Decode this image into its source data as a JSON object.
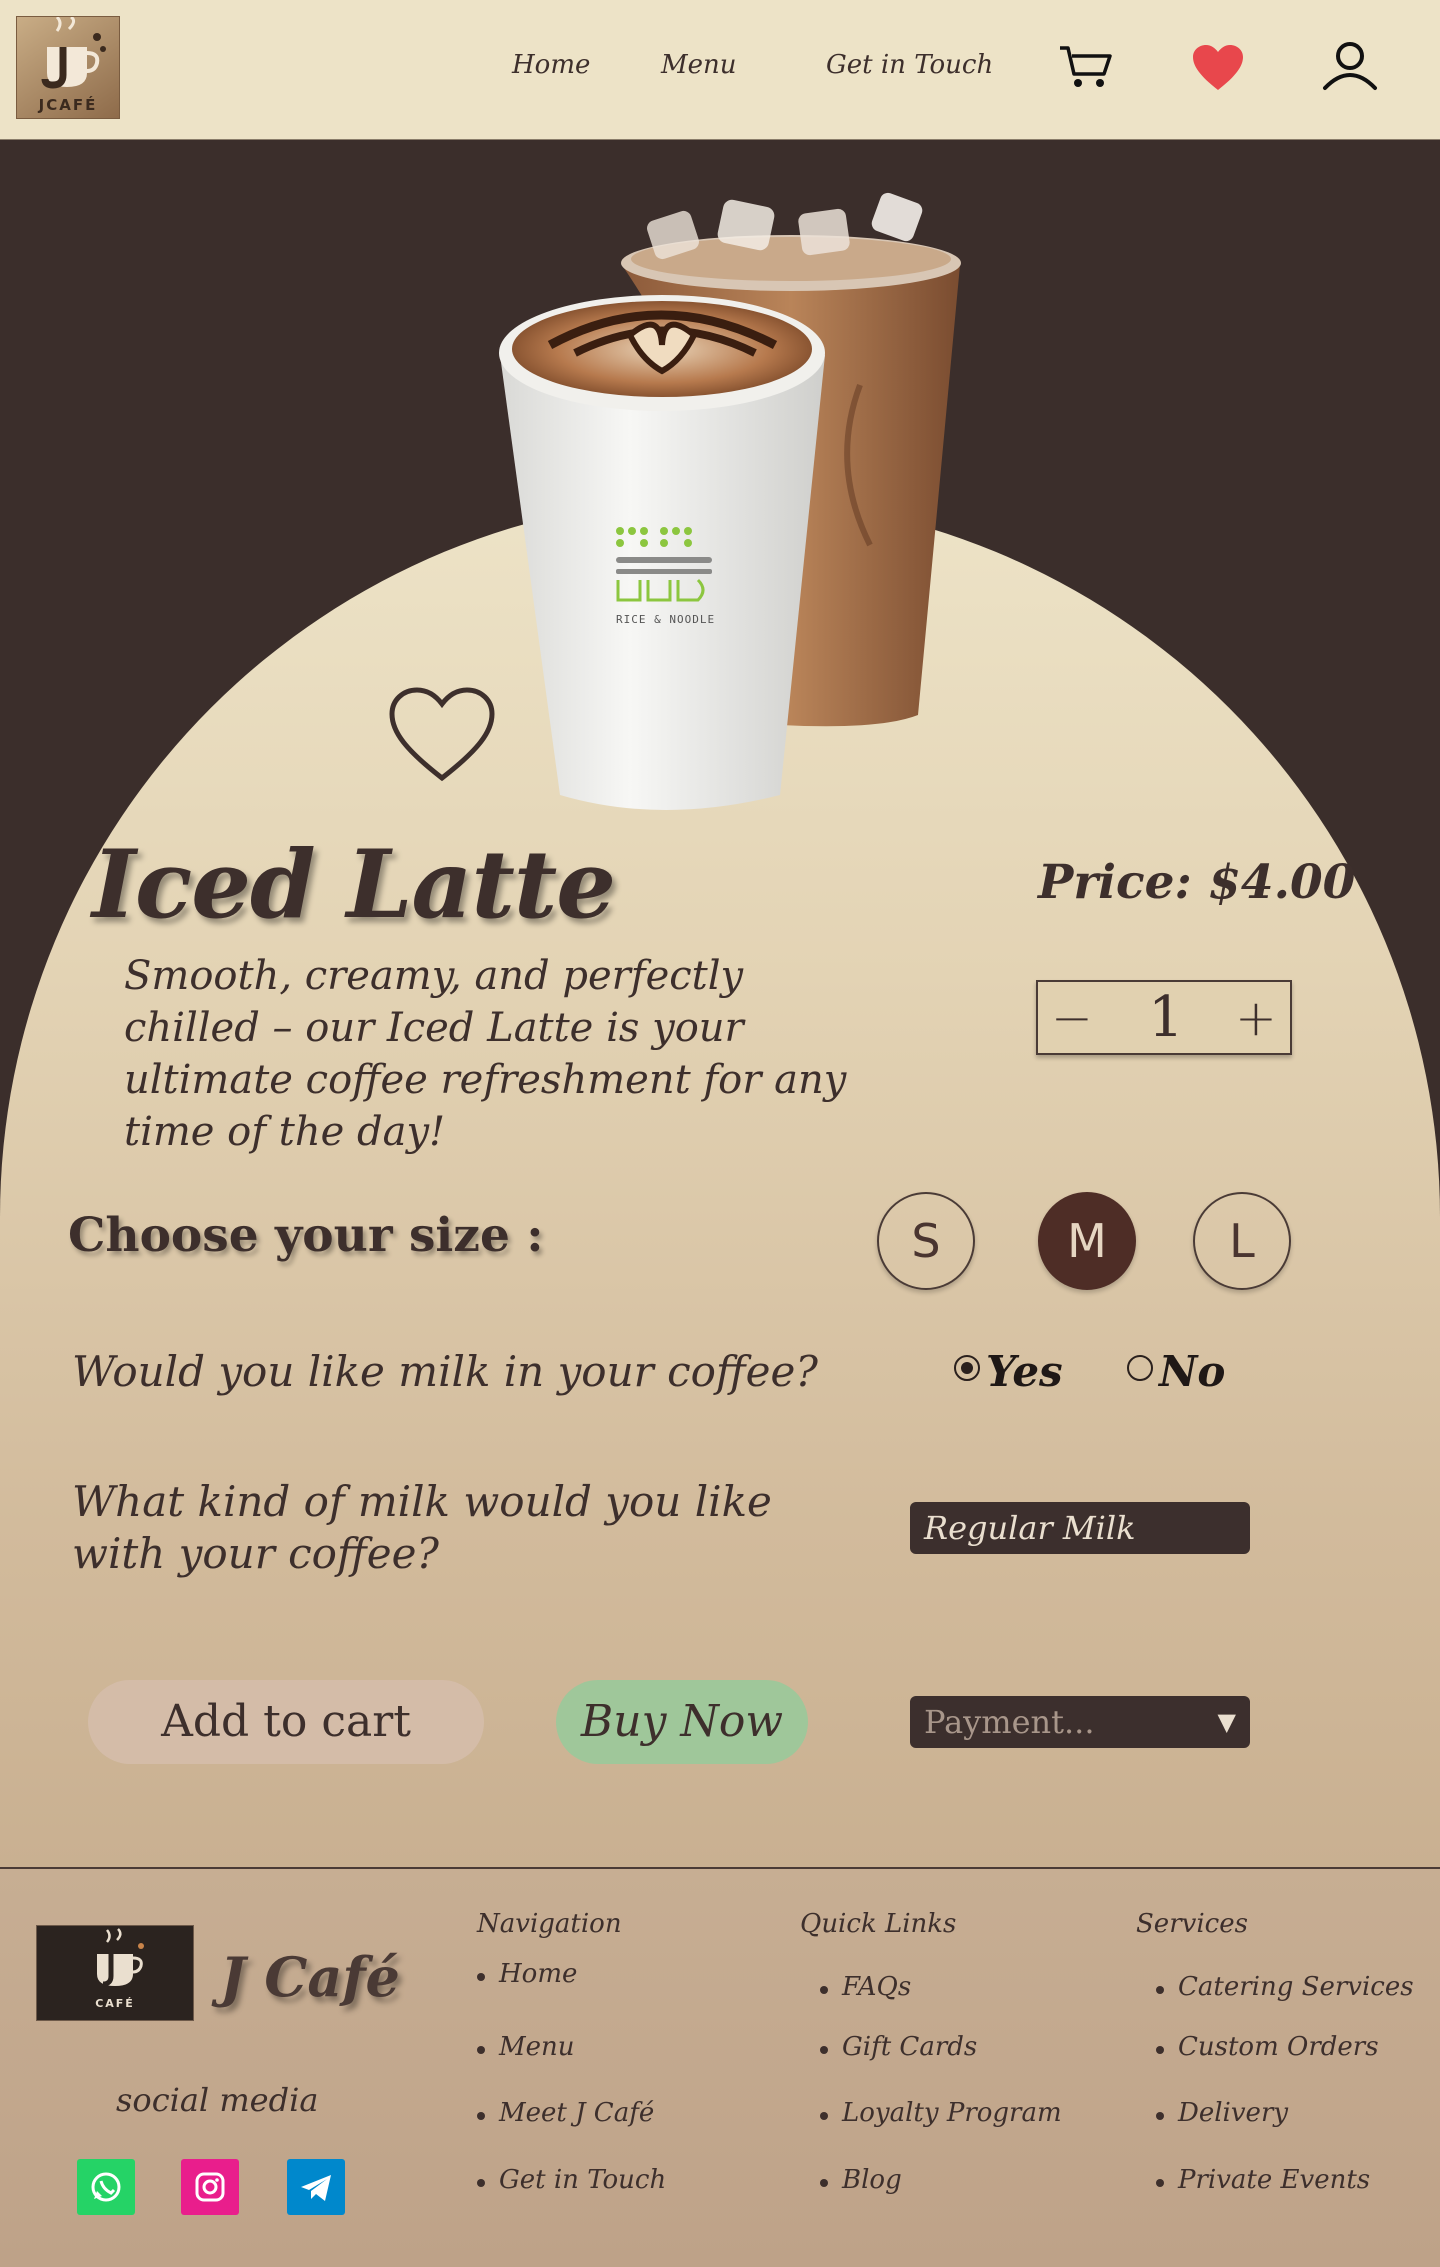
{
  "header": {
    "logo_text": "JCAFÉ",
    "nav": [
      "Home",
      "Menu",
      "Get in Touch"
    ],
    "icons": [
      "cart-icon",
      "heart-icon",
      "user-icon"
    ],
    "heart_color": "#e8474c"
  },
  "product": {
    "title": "Iced Latte",
    "description": "Smooth, creamy, and perfectly chilled – our Iced Latte is your ultimate coffee refreshment for any time of the day!",
    "price": "Price: $4.00",
    "quantity": "1",
    "decrement": "−",
    "increment": "+",
    "cup_brand": "RICE & NOODLE"
  },
  "size": {
    "label": "Choose your size :",
    "options": [
      "S",
      "M",
      "L"
    ],
    "selected": "M"
  },
  "milk": {
    "question": "Would you like milk in your coffee?",
    "options": [
      "Yes",
      "No"
    ],
    "selected": "Yes",
    "kind_question": "What kind of milk would you like with your coffee?",
    "kind_value": "Regular Milk"
  },
  "actions": {
    "add_to_cart": "Add to cart",
    "buy_now": "Buy Now",
    "payment_placeholder": "Payment...",
    "payment_caret": "▼"
  },
  "footer": {
    "logo_text": "CAFÉ",
    "brand": "J Café",
    "social_title": "social media",
    "social": [
      "whatsapp-icon",
      "instagram-icon",
      "telegram-icon"
    ],
    "navigation": {
      "title": "Navigation",
      "items": [
        "Home",
        "Menu",
        "Meet J Café",
        "Get in Touch"
      ]
    },
    "quick_links": {
      "title": "Quick Links",
      "items": [
        "FAQs",
        "Gift Cards",
        "Loyalty Program",
        "Blog"
      ]
    },
    "services": {
      "title": "Services",
      "items": [
        "Catering Services",
        "Custom Orders",
        "Delivery",
        "Private Events"
      ]
    }
  },
  "colors": {
    "header_bg": "#ede3c7",
    "dark_brown": "#3b2e2b",
    "selected_size": "#4e2d26",
    "buy_now": "#9fc79a",
    "add_to_cart": "#d4bca8"
  }
}
